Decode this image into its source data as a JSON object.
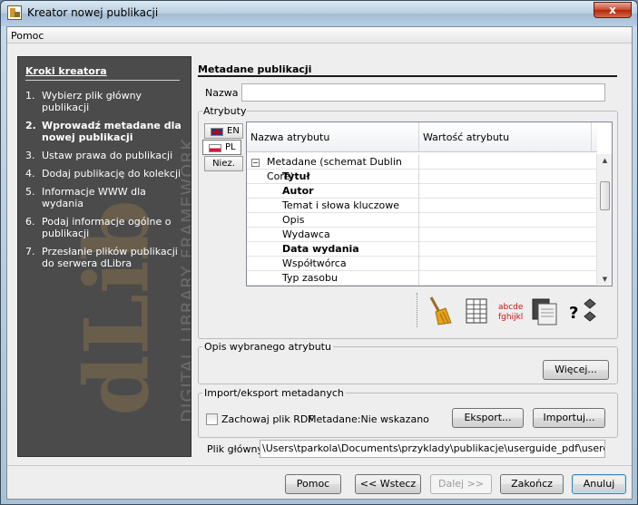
{
  "window": {
    "title": "Kreator nowej publikacji",
    "close_label": "x"
  },
  "menubar": {
    "help": "Pomoc"
  },
  "sidebar": {
    "title": "Kroki kreatora",
    "watermark_big": "dLib",
    "watermark_small": "DIGITAL LIBRARY FRAMEWORK",
    "steps": [
      {
        "num": "1.",
        "label": "Wybierz plik główny publikacji"
      },
      {
        "num": "2.",
        "label": "Wprowadź metadane dla nowej publikacji"
      },
      {
        "num": "3.",
        "label": "Ustaw prawa do publikacji"
      },
      {
        "num": "4.",
        "label": "Dodaj publikację do kolekcji"
      },
      {
        "num": "5.",
        "label": "Informacje WWW dla wydania"
      },
      {
        "num": "6.",
        "label": "Podaj informacje ogólne o publikacji"
      },
      {
        "num": "7.",
        "label": "Przesłanie plików publikacji do serwera dLibra"
      }
    ],
    "active_step": 2
  },
  "main": {
    "section_title": "Metadane publikacji",
    "name_label": "Nazwa",
    "name_value": "",
    "attributes_group": "Atrybuty",
    "lang_tabs": [
      {
        "code": "EN",
        "flag": "flag-en"
      },
      {
        "code": "PL",
        "flag": "flag-pl"
      },
      {
        "code": "Niez."
      }
    ],
    "table": {
      "columns": [
        "Nazwa atrybutu",
        "Wartość atrybutu"
      ],
      "rows": [
        {
          "name": "Metadane (schemat Dublin Core)",
          "bold": false,
          "root": true,
          "expander": "−"
        },
        {
          "name": "Tytuł",
          "bold": true
        },
        {
          "name": "Autor",
          "bold": true
        },
        {
          "name": "Temat i słowa kluczowe",
          "bold": false
        },
        {
          "name": "Opis",
          "bold": false
        },
        {
          "name": "Wydawca",
          "bold": false
        },
        {
          "name": "Data wydania",
          "bold": true
        },
        {
          "name": "Współtwórca",
          "bold": false
        },
        {
          "name": "Typ zasobu",
          "bold": false
        }
      ]
    },
    "toolbar_icons": [
      "broom-icon",
      "table-icon",
      "spellcheck-icon",
      "copy-icon",
      "help-icon"
    ],
    "spell_text_1": "abcde",
    "spell_text_2": "fghijkl",
    "help_glyph": "?",
    "description_group": "Opis wybranego atrybutu",
    "more_button": "Więcej...",
    "import_export_group": "Import/eksport metadanych",
    "keep_rdf_label": "Zachowaj plik RDF",
    "keep_rdf_checked": false,
    "metadata_status": "Metadane:Nie wskazano",
    "export_button": "Eksport...",
    "import_button": "Importuj...",
    "main_file_label": "Plik główny",
    "main_file_value": "\\Users\\tparkola\\Documents\\przyklady\\publikacje\\userguide_pdf\\userguide.pdf"
  },
  "footer": {
    "help": "Pomoc",
    "back": "<< Wstecz",
    "next": "Dalej >>",
    "finish": "Zakończ",
    "cancel": "Anuluj"
  },
  "colors": {
    "sidebar_bg": "#4b4b4b",
    "window_frame": "#b8cde0",
    "client_bg": "#eeeeee",
    "default_button_border": "#3c7fb1"
  }
}
